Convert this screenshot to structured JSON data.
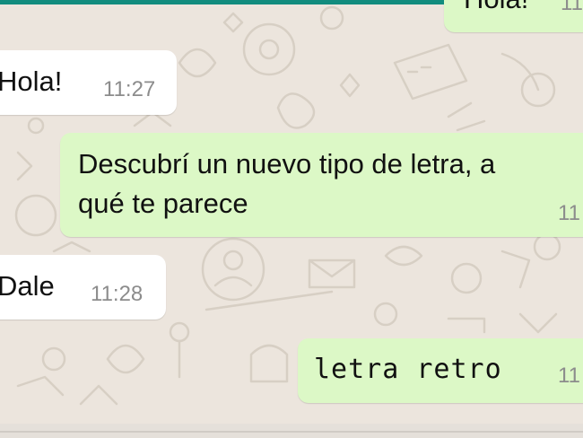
{
  "colors": {
    "chat_background": "#ece5dd",
    "incoming_bubble": "#ffffff",
    "outgoing_bubble": "#dcf8c6",
    "header_accent": "#128c7e",
    "timestamp": "#8c8c8c"
  },
  "messages": [
    {
      "direction": "outgoing",
      "text": "Hola!",
      "time": "11"
    },
    {
      "direction": "incoming",
      "text": "Hola!",
      "time": "11:27"
    },
    {
      "direction": "outgoing",
      "text_line1": "Descubrí un nuevo tipo de letra, a",
      "text_line2": "qué te parece",
      "time": "11"
    },
    {
      "direction": "incoming",
      "text": "Dale",
      "time": "11:28"
    },
    {
      "direction": "outgoing",
      "text": "letra retro",
      "time": "11"
    }
  ]
}
